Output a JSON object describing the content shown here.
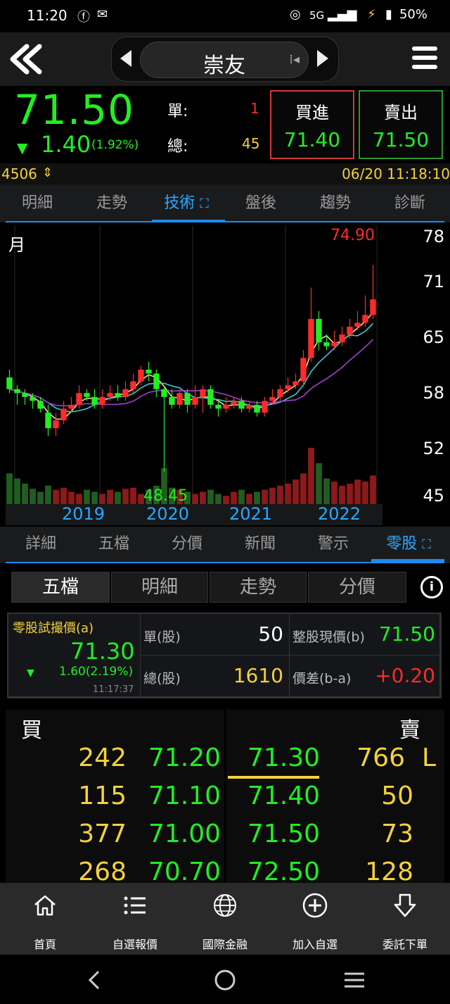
{
  "status_bar": {
    "time": "11:20",
    "network": "5G",
    "battery": "50%"
  },
  "header": {
    "stock_name": "崇友"
  },
  "quote": {
    "price": "71.50",
    "change": "1.40",
    "change_pct": "(1.92%)",
    "single_label": "單:",
    "single_value": "1",
    "total_label": "總:",
    "total_value": "45",
    "buy_label": "買進",
    "buy_price": "71.40",
    "sell_label": "賣出",
    "sell_price": "71.50"
  },
  "info_line": {
    "code": "4506",
    "datetime": "06/20 11:18:10"
  },
  "main_tabs": [
    "明細",
    "走勢",
    "技術",
    "盤後",
    "趨勢",
    "診斷"
  ],
  "main_tab_active": "技術",
  "chart_data": {
    "type": "candlestick",
    "period_label": "月",
    "high_label": "74.90",
    "low_label": "48.45",
    "y_ticks": [
      "78",
      "71",
      "65",
      "58",
      "52",
      "45"
    ],
    "x_labels": [
      "2019",
      "2020",
      "2021",
      "2022"
    ],
    "ylim": [
      45,
      78
    ],
    "candles": [
      [
        60.5,
        59.0,
        61.5,
        58.5
      ],
      [
        59.0,
        58.5,
        59.5,
        57.0
      ],
      [
        58.5,
        58.0,
        59.0,
        57.0
      ],
      [
        58.0,
        57.5,
        58.5,
        56.5
      ],
      [
        57.5,
        56.5,
        58.0,
        56.0
      ],
      [
        56.0,
        54.0,
        57.0,
        53.0
      ],
      [
        54.0,
        55.0,
        56.0,
        53.0
      ],
      [
        55.0,
        56.5,
        57.5,
        54.5
      ],
      [
        56.5,
        57.0,
        58.0,
        56.0
      ],
      [
        57.0,
        58.5,
        59.5,
        56.5
      ],
      [
        58.5,
        58.0,
        59.0,
        57.5
      ],
      [
        58.0,
        57.0,
        59.0,
        56.5
      ],
      [
        57.0,
        58.0,
        59.0,
        56.5
      ],
      [
        58.0,
        58.5,
        59.5,
        57.5
      ],
      [
        58.5,
        58.0,
        59.5,
        57.5
      ],
      [
        58.0,
        59.0,
        60.0,
        57.5
      ],
      [
        59.0,
        60.0,
        61.0,
        58.5
      ],
      [
        60.0,
        61.5,
        62.0,
        59.5
      ],
      [
        61.5,
        61.0,
        62.5,
        60.0
      ],
      [
        61.0,
        59.0,
        61.5,
        58.0
      ],
      [
        59.0,
        58.0,
        59.5,
        48.45
      ],
      [
        58.0,
        57.0,
        59.0,
        56.5
      ],
      [
        57.0,
        58.5,
        59.0,
        56.5
      ],
      [
        58.5,
        57.0,
        59.0,
        56.0
      ],
      [
        57.0,
        58.0,
        59.5,
        56.5
      ],
      [
        58.0,
        59.0,
        59.5,
        56.0
      ],
      [
        59.0,
        57.0,
        59.5,
        56.5
      ],
      [
        57.0,
        56.5,
        57.5,
        55.5
      ],
      [
        56.5,
        57.0,
        58.0,
        56.0
      ],
      [
        57.0,
        57.5,
        58.0,
        56.5
      ],
      [
        57.5,
        56.5,
        58.0,
        56.0
      ],
      [
        56.5,
        57.0,
        57.5,
        56.0
      ],
      [
        57.0,
        56.0,
        57.5,
        55.5
      ],
      [
        56.0,
        57.5,
        58.0,
        55.5
      ],
      [
        57.5,
        58.0,
        59.0,
        57.0
      ],
      [
        58.0,
        59.0,
        59.5,
        57.5
      ],
      [
        59.0,
        59.5,
        60.5,
        58.5
      ],
      [
        59.5,
        60.0,
        61.0,
        59.0
      ],
      [
        60.0,
        63.0,
        64.0,
        59.5
      ],
      [
        63.0,
        68.0,
        72.0,
        62.5
      ],
      [
        68.0,
        65.0,
        69.0,
        64.0
      ],
      [
        65.0,
        64.5,
        66.0,
        64.0
      ],
      [
        64.5,
        65.0,
        66.5,
        64.0
      ],
      [
        65.0,
        66.0,
        67.0,
        64.5
      ],
      [
        66.0,
        67.0,
        68.0,
        65.5
      ],
      [
        67.0,
        67.5,
        69.0,
        66.5
      ],
      [
        67.5,
        68.5,
        71.0,
        67.0
      ],
      [
        68.5,
        70.5,
        74.9,
        68.0
      ]
    ],
    "volumes": [
      30,
      25,
      20,
      15,
      12,
      18,
      14,
      16,
      12,
      10,
      14,
      12,
      10,
      14,
      12,
      15,
      16,
      10,
      14,
      18,
      35,
      16,
      14,
      12,
      10,
      12,
      14,
      10,
      8,
      12,
      14,
      10,
      12,
      14,
      16,
      18,
      20,
      24,
      30,
      55,
      40,
      25,
      22,
      18,
      20,
      24,
      22,
      28
    ],
    "ma_series": [
      "5-period",
      "10-period",
      "20-period"
    ]
  },
  "sub_tabs": [
    "詳細",
    "五檔",
    "分價",
    "新聞",
    "警示",
    "零股"
  ],
  "sub_tab_active": "零股",
  "seg_tabs": [
    "五檔",
    "明細",
    "走勢",
    "分價"
  ],
  "seg_active": "五檔",
  "odd_lot": {
    "title": "零股試撮價(a)",
    "price": "71.30",
    "change": "1.60(2.19%)",
    "time": "11:17:37",
    "unit_label": "單(股)",
    "unit_value": "50",
    "total_label": "總(股)",
    "total_value": "1610",
    "board_price_label": "整股現價(b)",
    "board_price_value": "71.50",
    "diff_label": "價差(b-a)",
    "diff_value": "+0.20"
  },
  "order_book": {
    "buy_label": "買",
    "sell_label": "賣",
    "rows": [
      {
        "bid_qty": "242",
        "bid": "71.20",
        "ask": "71.30",
        "ask_qty": "766",
        "flag": "L"
      },
      {
        "bid_qty": "115",
        "bid": "71.10",
        "ask": "71.40",
        "ask_qty": "50",
        "flag": ""
      },
      {
        "bid_qty": "377",
        "bid": "71.00",
        "ask": "71.50",
        "ask_qty": "73",
        "flag": ""
      },
      {
        "bid_qty": "268",
        "bid": "70.70",
        "ask": "72.50",
        "ask_qty": "128",
        "flag": ""
      }
    ]
  },
  "bottom_nav": [
    {
      "label": "首頁",
      "icon": "home-icon"
    },
    {
      "label": "自選報價",
      "icon": "list-icon"
    },
    {
      "label": "國際金融",
      "icon": "globe-icon"
    },
    {
      "label": "加入自選",
      "icon": "plus-circle-icon"
    },
    {
      "label": "委託下單",
      "icon": "order-arrow-icon"
    }
  ],
  "colors": {
    "up": "#ff2a2a",
    "down": "#22ee22",
    "accent": "#2aa8ff",
    "highlight": "#f4d23a"
  }
}
